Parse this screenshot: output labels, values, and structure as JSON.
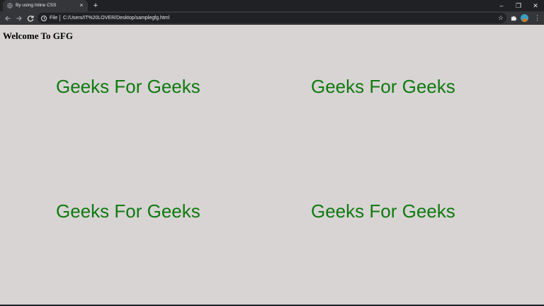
{
  "browser": {
    "tab_title": "By using Inline CSS",
    "tab_close": "×",
    "new_tab": "+",
    "url_scheme": "File",
    "url": "C:/Users/IT%20LOVER/Desktop/samplegfg.html",
    "window_controls": {
      "minimize": "–",
      "restore": "❐",
      "close": "✕"
    }
  },
  "page": {
    "heading": "Welcome To GFG",
    "boxes": [
      {
        "text": "Geeks For Geeks"
      },
      {
        "text": "Geeks For Geeks"
      },
      {
        "text": "Geeks For Geeks"
      },
      {
        "text": "Geeks For Geeks"
      }
    ],
    "text_color": "#0f7a0f",
    "background_color": "#d8d4d4"
  },
  "icons": {
    "back": "back-arrow-icon",
    "forward": "forward-arrow-icon",
    "reload": "reload-icon",
    "info": "info-icon",
    "bookmark": "star-icon",
    "extensions": "puzzle-icon",
    "profile": "avatar-icon",
    "menu": "kebab-menu-icon"
  }
}
